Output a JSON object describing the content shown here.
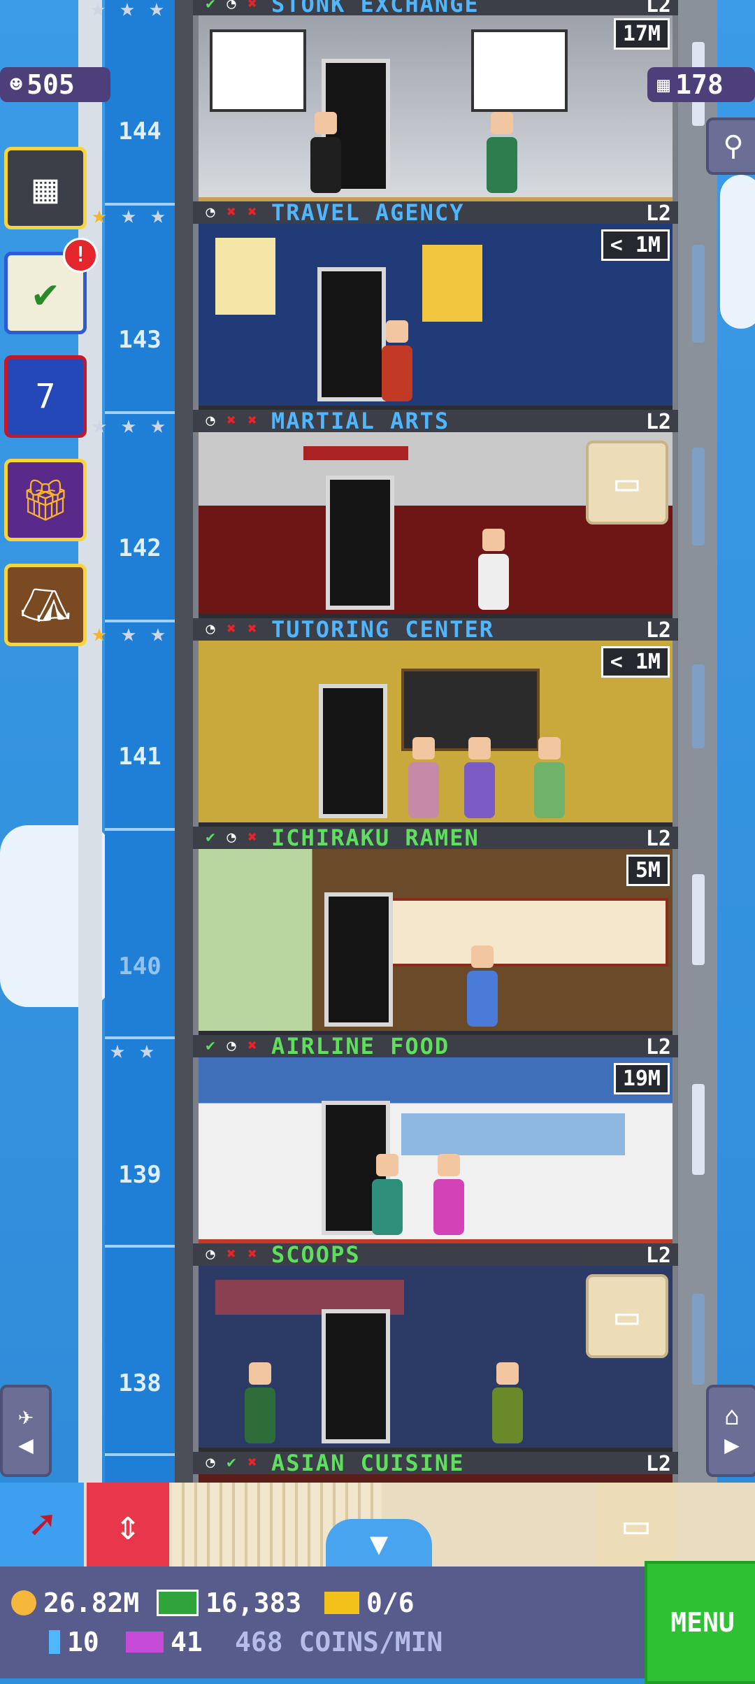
{
  "top_left": {
    "population": "505"
  },
  "top_right": {
    "bux": "178"
  },
  "floors": [
    {
      "num": "144",
      "name": "STONK EXCHANGE",
      "level": "L2",
      "price": "17M",
      "name_color": "#4fb6ff"
    },
    {
      "num": "143",
      "name": "TRAVEL AGENCY",
      "level": "L2",
      "price": "< 1M",
      "name_color": "#4fb6ff"
    },
    {
      "num": "142",
      "name": "MARTIAL ARTS",
      "level": "L2",
      "price": "",
      "name_color": "#4fb6ff"
    },
    {
      "num": "141",
      "name": "TUTORING CENTER",
      "level": "L2",
      "price": "< 1M",
      "name_color": "#4fb6ff"
    },
    {
      "num": "140",
      "name": "ICHIRAKU RAMEN",
      "level": "L2",
      "price": "5M",
      "name_color": "#5ee05e"
    },
    {
      "num": "139",
      "name": "AIRLINE FOOD",
      "level": "L2",
      "price": "19M",
      "name_color": "#5ee05e"
    },
    {
      "num": "138",
      "name": "SCOOPS",
      "level": "L2",
      "price": "",
      "name_color": "#5ee05e"
    },
    {
      "num": "",
      "name": "ASIAN CUISINE",
      "level": "L2",
      "price": "",
      "name_color": "#5ee05e"
    }
  ],
  "status": {
    "coins": "26.82M",
    "bux": "16,383",
    "tickets": "0/6",
    "keys": "10",
    "vip": "41",
    "rate": "468 COINS/MIN",
    "menu": "MENU"
  },
  "sidebar": {
    "badge": "!",
    "calendar_day": "7"
  },
  "colors": {
    "accent_green": "#2ec133",
    "accent_red": "#e3262b",
    "coin": "#f5b83b"
  }
}
